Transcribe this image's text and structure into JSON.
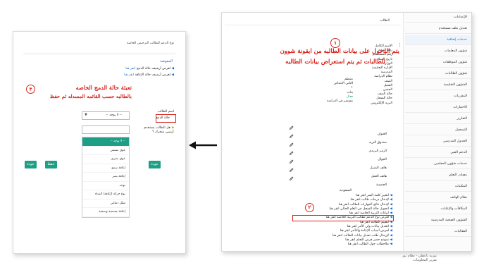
{
  "left_panel": {
    "header": "نوع الدعم للطالب الترخيص الخاصة",
    "subtitle": "المفوضة",
    "link1_text": "لعرض أرشيف حالة الدمج",
    "link1_action": "انقر هنا",
    "link2_text": "لعرض أرشيف حالة الإعاقة",
    "link2_action": "انقر هنا",
    "annotation_number": "٣",
    "annotation_line1": "تعبئة حالة الدمج الخاصه",
    "annotation_line2": "بالطالبه حسب القائمه المسدله ثم حفظ",
    "field_label1": "اسم الطالب",
    "field_label2": "حالة الدمج",
    "checkbox_label": "هل الطالب يستخدم كرسي متحرك ؟",
    "select_value": "-- لا يوجد --",
    "dropdown_options": [
      "-- لا يوجد --",
      "عوق سمعي",
      "عوق بصري",
      "إعاقة سمع",
      "إعاقة بصر",
      "توحد",
      "نوع حركة (إعاقة) الشاه",
      "شلل دماغي",
      "إعاقة جسمية وصحية"
    ],
    "buttons": {
      "save": "حفظ",
      "back": "عودة",
      "close": "عودة"
    }
  },
  "right_panel": {
    "page_title": "الطالب",
    "annotation_number": "١",
    "annotation_line1": "يتم الدخول على بيانات الطالبه من ايقونة شوون",
    "annotation_line2": "الطالبات ثم يتم استعراض بيانات الطالبه",
    "annotation2_number": "٢",
    "fields": [
      "الاسم الكامل",
      "رقم الهوية",
      "رقم المستخدم",
      "تاريخ الميلاد",
      "الوزارة",
      "الإدارة التعليمية",
      "المدرسة",
      "نظام الدراسة",
      "الصف",
      "الفصل",
      "الجنس",
      "حالة الصف",
      "حالة السجل",
      "البريد الإلكتروني"
    ],
    "values": [
      "منتظم",
      "الثاني الابتدائي",
      "١",
      "بنات",
      "فعال",
      "مستمر في الدراسة"
    ],
    "editable_fields": [
      "العنوان",
      "صندوق البريد",
      "الرمز البريدي",
      "الجوال",
      "هاتف المنزل",
      "هاتف العمل",
      "الجنسية"
    ],
    "nationality_value": "السعودية",
    "links": [
      "لتغيير كلمة السر انقر هنا",
      "لإدخال درجات طالب انقر هنا",
      "لإدخال نتائج المهارات للطالب انقر هنا",
      "لتحويل حالة السجل في العام الحالي انقر هنا",
      "لبيانات التربية الخاصة انقر هنا",
      "لعرض نوع الدعم لطالب التربية الخاصة انقر هنا",
      "لتقييم الطالبة انقر هنا",
      "لتعديل بيانات ولي الأمر انقر هنا",
      "لعرض أسباب الإعادة والتأخر انقر هنا",
      "لإرسال طلب تعديل بيانات الطالب انقر هنا",
      "نموذج حصر فرص التعلم انقر هنا",
      "ملاحظات حول الطالب انقر هنا"
    ],
    "sidebar": [
      "الإعدادات",
      "تعديل ملف مستخدم",
      "خدمات إضافية",
      "شؤون المعلمات",
      "شؤون الموظفات",
      "شؤون الطالبات",
      "الشؤون التعليمية",
      "المقررات",
      "الاختبارات",
      "التقارير",
      "التسجيل",
      "الجدول المدرسي",
      "الدعم الفني",
      "خدمات شؤون المعلمين",
      "مصادر التعلم",
      "المكتبات",
      "نظام الهاتف",
      "المكافآت والإعانات",
      "الشؤون الصحية المدرسية",
      "الفعاليات"
    ]
  },
  "caption_line1": "توريه باعطي - نظام نور",
  "caption_line2": "تقرير المعلومات"
}
